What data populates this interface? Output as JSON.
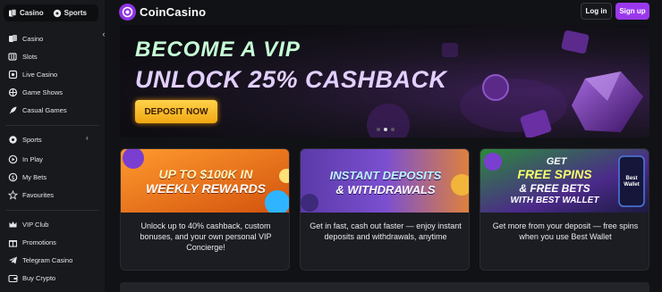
{
  "sidebar": {
    "tabs": [
      {
        "label": "Casino",
        "icon": "cards-icon"
      },
      {
        "label": "Sports",
        "icon": "ball-icon"
      }
    ],
    "casino_items": [
      {
        "label": "Casino",
        "icon": "cards-icon"
      },
      {
        "label": "Slots",
        "icon": "slot-icon"
      },
      {
        "label": "Live Casino",
        "icon": "live-icon"
      },
      {
        "label": "Game Shows",
        "icon": "wheel-icon"
      },
      {
        "label": "Casual Games",
        "icon": "rocket-icon"
      }
    ],
    "sports_items": [
      {
        "label": "Sports",
        "icon": "ball-icon"
      },
      {
        "label": "In Play",
        "icon": "play-icon"
      },
      {
        "label": "My Bets",
        "icon": "dollar-icon"
      },
      {
        "label": "Favourites",
        "icon": "star-icon"
      }
    ],
    "other_items": [
      {
        "label": "VIP Club",
        "icon": "crown-icon"
      },
      {
        "label": "Promotions",
        "icon": "gift-icon"
      },
      {
        "label": "Telegram Casino",
        "icon": "telegram-icon"
      },
      {
        "label": "Buy Crypto",
        "icon": "wallet-icon"
      }
    ]
  },
  "header": {
    "logo_text": "CoinCasino",
    "login_label": "Log in",
    "signup_label": "Sign up"
  },
  "hero": {
    "line1": "BECOME A VIP",
    "line2": "UNLOCK 25% CASHBACK",
    "cta_label": "DEPOSIT NOW",
    "slides": 3,
    "active_slide": 1
  },
  "promos": [
    {
      "headline_1": "UP TO $100K IN",
      "headline_2": "WEEKLY REWARDS",
      "description": "Unlock up to 40% cashback, custom bonuses, and your own personal VIP Concierge!"
    },
    {
      "headline_1": "INSTANT DEPOSITS",
      "headline_2": "& WITHDRAWALS",
      "description": "Get in fast, cash out faster — enjoy instant deposits and withdrawals, anytime"
    },
    {
      "headline_1": "GET",
      "headline_2": "FREE SPINS",
      "headline_3": "& FREE BETS",
      "headline_4": "WITH BEST WALLET",
      "badge": "Best Wallet",
      "description": "Get more from your deposit — free spins when you use Best Wallet"
    }
  ],
  "colors": {
    "accent": "#9a38ee",
    "cta": "#f0a712",
    "background": "#111215",
    "sidebar": "#18191d"
  }
}
